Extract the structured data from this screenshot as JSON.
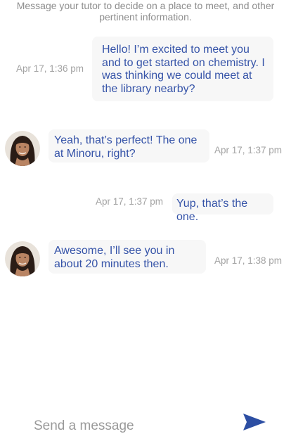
{
  "intro": {
    "text": "Message your tutor to decide on a place to meet, and other pertinent information."
  },
  "messages": [
    {
      "sender": "me",
      "text": "Hello! I’m excited to meet you and to get started on chemistry. I was thinking we could meet at the library nearby?",
      "timestamp": "Apr 17, 1:36 pm"
    },
    {
      "sender": "tutor",
      "text": "Yeah, that’s perfect! The one at Minoru, right?",
      "timestamp": "Apr 17, 1:37 pm",
      "avatar": "tutor-avatar"
    },
    {
      "sender": "me",
      "text": "Yup, that’s the one.",
      "timestamp": "Apr 17, 1:37 pm"
    },
    {
      "sender": "tutor",
      "text": "Awesome, I’ll see you in about 20 minutes then.",
      "timestamp": "Apr 17, 1:38 pm",
      "avatar": "tutor-avatar"
    }
  ],
  "composer": {
    "placeholder": "Send a message",
    "value": "",
    "send_icon": "send-icon"
  },
  "colors": {
    "accent": "#2c4ea3",
    "bubble_bg": "#f7f7f7",
    "message_text": "#3553a8",
    "timestamp": "#a3a3a3"
  }
}
